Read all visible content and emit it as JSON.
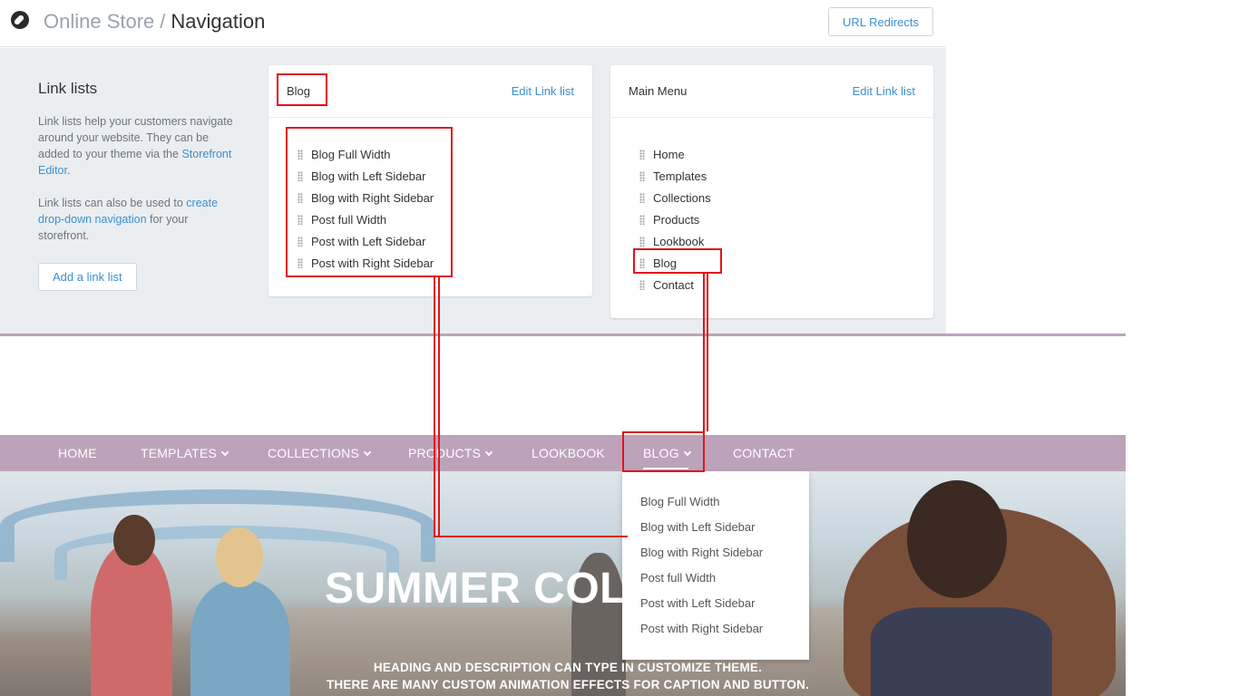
{
  "header": {
    "breadcrumb_parent": "Online Store",
    "breadcrumb_sep": "/",
    "breadcrumb_current": "Navigation",
    "url_redirects_label": "URL Redirects"
  },
  "sidebar": {
    "title": "Link lists",
    "desc1": "Link lists help your customers navigate around your website. They can be added to your theme via the ",
    "desc1_link": "Storefront Editor",
    "desc1_end": ".",
    "desc2": "Link lists can also be used to ",
    "desc2_link": "create drop-down navigation",
    "desc2_end": " for your storefront.",
    "add_label": "Add a link list"
  },
  "blog_card": {
    "title": "Blog",
    "edit_label": "Edit Link list",
    "items": [
      "Blog Full Width",
      "Blog with Left Sidebar",
      "Blog with Right Sidebar",
      "Post full Width",
      "Post with Left Sidebar",
      "Post with Right Sidebar"
    ]
  },
  "main_menu_card": {
    "title": "Main Menu",
    "edit_label": "Edit Link list",
    "items": [
      "Home",
      "Templates",
      "Collections",
      "Products",
      "Lookbook",
      "Blog",
      "Contact"
    ]
  },
  "storefront_nav": {
    "items": [
      "HOME",
      "TEMPLATES",
      "COLLECTIONS",
      "PRODUCTS",
      "LOOKBOOK",
      "BLOG",
      "CONTACT"
    ]
  },
  "dropdown": {
    "items": [
      "Blog Full Width",
      "Blog with Left Sidebar",
      "Blog with Right Sidebar",
      "Post full Width",
      "Post with Left Sidebar",
      "Post with Right Sidebar"
    ]
  },
  "hero": {
    "title": "SUMMER COLL",
    "sub1": "HEADING AND DESCRIPTION CAN TYPE IN CUSTOMIZE THEME.",
    "sub2": "THERE ARE MANY CUSTOM ANIMATION EFFECTS FOR CAPTION AND BUTTON."
  },
  "colors": {
    "accent_link": "#3c8fcf",
    "nav_bg": "#bda3ba",
    "annotation_red": "#e0141b",
    "admin_bg": "#ebeef0"
  },
  "icons": {
    "app_icon": "compass-icon",
    "drag_handle": "drag-handle-icon",
    "dropdown_caret": "chevron-down-icon"
  }
}
